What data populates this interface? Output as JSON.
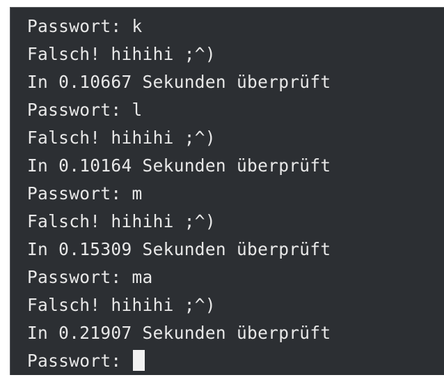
{
  "terminal": {
    "lines": [
      "Passwort: k",
      "Falsch! hihihi ;^)",
      "In 0.10667 Sekunden überprüft",
      "Passwort: l",
      "Falsch! hihihi ;^)",
      "In 0.10164 Sekunden überprüft",
      "Passwort: m",
      "Falsch! hihihi ;^)",
      "In 0.15309 Sekunden überprüft",
      "Passwort: ma",
      "Falsch! hihihi ;^)",
      "In 0.21907 Sekunden überprüft"
    ],
    "prompt": "Passwort: ",
    "colors": {
      "background": "#2c2f33",
      "text": "#e8e8e8",
      "cursor": "#f2f2f2"
    }
  }
}
